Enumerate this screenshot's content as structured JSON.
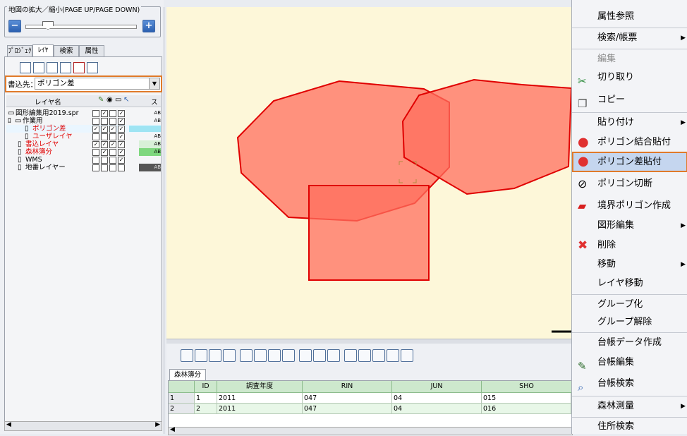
{
  "zoom": {
    "title": "地図の拡大／縮小(PAGE UP/PAGE DOWN)",
    "minus": "−",
    "plus": "+"
  },
  "tabs": [
    "ﾌﾟﾛｼﾞｪｸﾄ",
    "ﾚｲﾔ",
    "検索",
    "属性"
  ],
  "dest": {
    "label": "書込先：",
    "value": "ポリゴン差"
  },
  "layer_header": {
    "name": "レイヤ名",
    "style": "ス"
  },
  "layers": [
    {
      "name": "図形編集用2019.spr",
      "color": "#000000",
      "style": "AB"
    },
    {
      "name": "作業用",
      "color": "#000000",
      "style": "AB"
    },
    {
      "name": "ポリゴン差",
      "color": "#e00000",
      "style": ""
    },
    {
      "name": "ユーザレイヤ",
      "color": "#e00000",
      "style": "AB"
    },
    {
      "name": "書込レイヤ",
      "color": "#e00000",
      "style": "AB"
    },
    {
      "name": "森林簿分",
      "color": "#e00000",
      "style": "AB"
    },
    {
      "name": "WMS",
      "color": "#000000",
      "style": ""
    },
    {
      "name": "地番レイヤー",
      "color": "#000000",
      "style": "AB"
    }
  ],
  "bottom": {
    "tab": "森林簿分",
    "columns": [
      "ID",
      "調査年度",
      "RIN",
      "JUN",
      "SHO"
    ],
    "rows": [
      {
        "num": "1",
        "ID": "1",
        "year": "2011",
        "RIN": "047",
        "JUN": "04",
        "SHO": "015"
      },
      {
        "num": "2",
        "ID": "2",
        "year": "2011",
        "RIN": "047",
        "JUN": "04",
        "SHO": "016"
      }
    ]
  },
  "menu": {
    "items": [
      {
        "label": "属性参照"
      },
      {
        "label": "検索/帳票"
      },
      {
        "label": "編集"
      },
      {
        "label": "切り取り"
      },
      {
        "label": "コピー"
      },
      {
        "label": "貼り付け"
      },
      {
        "label": "ポリゴン結合貼付"
      },
      {
        "label": "ポリゴン差貼付"
      },
      {
        "label": "ポリゴン切断"
      },
      {
        "label": "境界ポリゴン作成"
      },
      {
        "label": "図形編集"
      },
      {
        "label": "削除"
      },
      {
        "label": "移動"
      },
      {
        "label": "レイヤ移動"
      },
      {
        "label": "グループ化"
      },
      {
        "label": "グループ解除"
      },
      {
        "label": "台帳データ作成"
      },
      {
        "label": "台帳編集"
      },
      {
        "label": "台帳検索"
      },
      {
        "label": "森林測量"
      },
      {
        "label": "住所検索"
      }
    ]
  },
  "colors": {
    "polygon_fill": "#ff6f5e",
    "polygon_stroke": "#e00000",
    "map_bg": "#fdf7d9",
    "highlight_border": "#e07a2a"
  }
}
